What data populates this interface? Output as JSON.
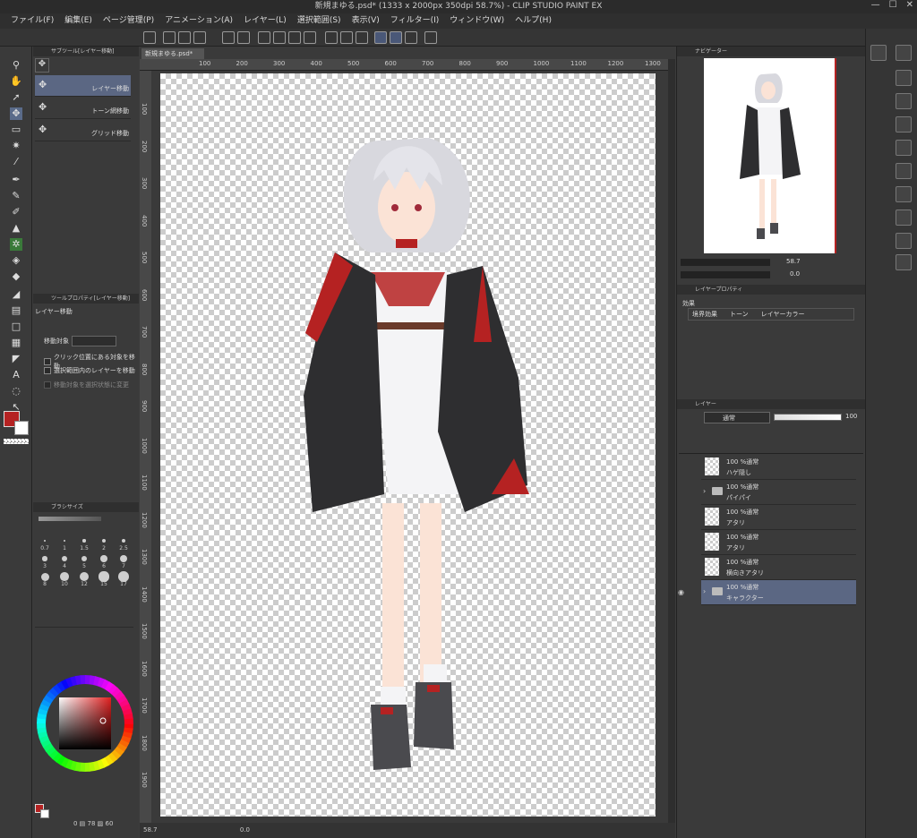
{
  "window": {
    "title": "新規まゆる.psd* (1333 x 2000px 350dpi 58.7%) - CLIP STUDIO PAINT EX",
    "controls": [
      "—",
      "☐",
      "✕"
    ]
  },
  "menu": [
    "ファイル(F)",
    "編集(E)",
    "ページ管理(P)",
    "アニメーション(A)",
    "レイヤー(L)",
    "選択範囲(S)",
    "表示(V)",
    "フィルター(I)",
    "ウィンドウ(W)",
    "ヘルプ(H)"
  ],
  "subtool_panel": {
    "title": "サブツール[レイヤー移動]",
    "items": [
      {
        "label": "レイヤー移動",
        "selected": true
      },
      {
        "label": "トーン網移動",
        "selected": false
      },
      {
        "label": "グリッド移動",
        "selected": false
      }
    ]
  },
  "tool_property": {
    "title": "ツールプロパティ[レイヤー移動]",
    "tool_name": "レイヤー移動",
    "target_label": "移動対象",
    "options": [
      {
        "label": "クリック位置にある対象を移動",
        "checked": false
      },
      {
        "label": "選択範囲内のレイヤーを移動",
        "checked": false
      },
      {
        "label": "移動対象を選択状態に変更",
        "checked": false
      }
    ]
  },
  "brush_size": {
    "title": "ブラシサイズ",
    "sizes": [
      "0.7",
      "1",
      "1.5",
      "2",
      "2.5",
      "3",
      "4",
      "5",
      "6",
      "7",
      "8",
      "10",
      "12",
      "15",
      "17"
    ]
  },
  "color_bar": {
    "main_color": "#b52222",
    "sub_color": "#ffffff",
    "readout": "0 ▤ 78 ▨ 60"
  },
  "document": {
    "tab": "新規まゆる.psd*",
    "ruler_top": [
      "100",
      "200",
      "300",
      "400",
      "500",
      "600",
      "700",
      "800",
      "900",
      "1000",
      "1100",
      "1200",
      "1300"
    ],
    "ruler_left": [
      "100",
      "200",
      "300",
      "400",
      "500",
      "600",
      "700",
      "800",
      "900",
      "1000",
      "1100",
      "1200",
      "1300",
      "1400",
      "1500",
      "1600",
      "1700",
      "1800",
      "1900"
    ],
    "zoom": "58.7",
    "rotation": "0.0"
  },
  "navigator": {
    "title": "ナビゲーター",
    "zoom": "58.7",
    "rotation": "0.0"
  },
  "layer_property": {
    "title": "レイヤープロパティ",
    "effect_label": "効果",
    "effects": [
      "境界効果",
      "トーン",
      "レイヤーカラー"
    ]
  },
  "layers_panel": {
    "title": "レイヤー",
    "blend_mode": "通常",
    "opacity": "100",
    "layers": [
      {
        "mode": "100 %通常",
        "name": "ハゲ隠し",
        "type": "raster",
        "selected": false,
        "visible": false
      },
      {
        "mode": "100 %通常",
        "name": "パイパイ",
        "type": "folder",
        "selected": false,
        "visible": false
      },
      {
        "mode": "100 %通常",
        "name": "アタリ",
        "type": "raster",
        "selected": false,
        "visible": false
      },
      {
        "mode": "100 %通常",
        "name": "アタリ",
        "type": "raster",
        "selected": false,
        "visible": false
      },
      {
        "mode": "100 %通常",
        "name": "横向きアタリ",
        "type": "raster",
        "selected": false,
        "visible": false
      },
      {
        "mode": "100 %通常",
        "name": "キャラクター",
        "type": "folder",
        "selected": true,
        "visible": true
      }
    ]
  },
  "colors": {
    "accent": "#5b6783",
    "panel": "#3a3a3a"
  }
}
